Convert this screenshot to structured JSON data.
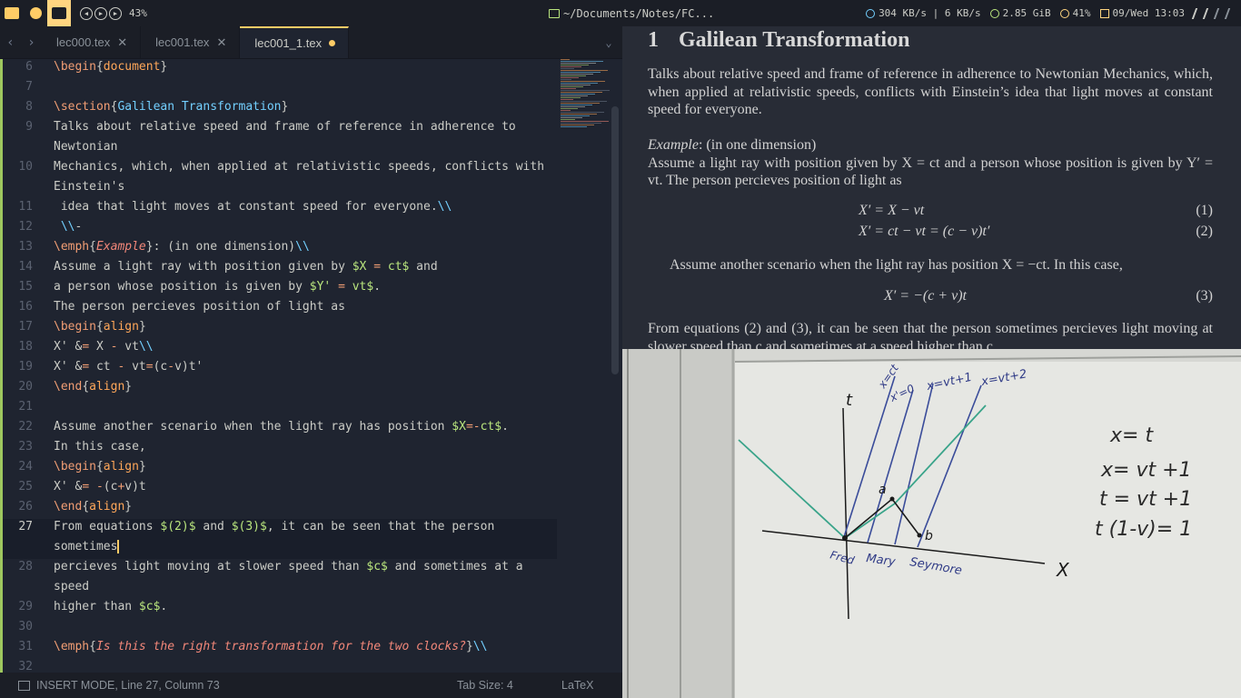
{
  "topbar": {
    "volume": "43%",
    "window_title": "~/Documents/Notes/FC...",
    "network": "304 KB/s | 6 KB/s",
    "memory": "2.85 GiB",
    "battery": "41%",
    "datetime": "09/Wed 13:03"
  },
  "tabs": [
    {
      "label": "lec000.tex",
      "active": false,
      "modified": false
    },
    {
      "label": "lec001.tex",
      "active": false,
      "modified": false
    },
    {
      "label": "lec001_1.tex",
      "active": true,
      "modified": true
    }
  ],
  "editor": {
    "lines": [
      {
        "n": "6",
        "segs": [
          [
            "fn",
            "\\begin"
          ],
          [
            "p",
            "{"
          ],
          [
            "kw",
            "document"
          ],
          [
            "p",
            "}"
          ]
        ]
      },
      {
        "n": "7",
        "segs": []
      },
      {
        "n": "8",
        "segs": [
          [
            "fn",
            "\\section"
          ],
          [
            "p",
            "{"
          ],
          [
            "arg",
            "Galilean Transformation"
          ],
          [
            "p",
            "}"
          ]
        ]
      },
      {
        "n": "9",
        "segs": [
          [
            "p",
            "Talks about relative speed and frame of reference in adherence to"
          ]
        ]
      },
      {
        "n": "",
        "segs": [
          [
            "p",
            "Newtonian"
          ]
        ]
      },
      {
        "n": "10",
        "segs": [
          [
            "p",
            "Mechanics, which, when applied at relativistic speeds, conflicts with"
          ]
        ]
      },
      {
        "n": "",
        "segs": [
          [
            "p",
            "Einstein's"
          ]
        ]
      },
      {
        "n": "11",
        "segs": [
          [
            "p",
            " idea that light moves at constant speed for everyone."
          ],
          [
            "arg",
            "\\\\"
          ]
        ]
      },
      {
        "n": "12",
        "segs": [
          [
            "p",
            " "
          ],
          [
            "arg",
            "\\\\"
          ],
          [
            "p",
            "-"
          ]
        ]
      },
      {
        "n": "13",
        "segs": [
          [
            "fn",
            "\\emph"
          ],
          [
            "p",
            "{"
          ],
          [
            "it",
            "Example"
          ],
          [
            "p",
            "}: (in one dimension)"
          ],
          [
            "arg",
            "\\\\"
          ]
        ]
      },
      {
        "n": "14",
        "segs": [
          [
            "p",
            "Assume a light ray with position given by "
          ],
          [
            "str",
            "$X "
          ],
          [
            "op",
            "="
          ],
          [
            "str",
            " ct$"
          ],
          [
            "p",
            " and"
          ]
        ]
      },
      {
        "n": "15",
        "segs": [
          [
            "p",
            "a person whose position is given by "
          ],
          [
            "str",
            "$Y' "
          ],
          [
            "op",
            "="
          ],
          [
            "str",
            " vt$"
          ],
          [
            "p",
            "."
          ]
        ]
      },
      {
        "n": "16",
        "segs": [
          [
            "p",
            "The person percieves position of light as"
          ]
        ]
      },
      {
        "n": "17",
        "segs": [
          [
            "fn",
            "\\begin"
          ],
          [
            "p",
            "{"
          ],
          [
            "kw",
            "align"
          ],
          [
            "p",
            "}"
          ]
        ]
      },
      {
        "n": "18",
        "segs": [
          [
            "p",
            "X' &"
          ],
          [
            "op",
            "="
          ],
          [
            "p",
            " X "
          ],
          [
            "op",
            "-"
          ],
          [
            "p",
            " vt"
          ],
          [
            "arg",
            "\\\\"
          ]
        ]
      },
      {
        "n": "19",
        "segs": [
          [
            "p",
            "X' &"
          ],
          [
            "op",
            "="
          ],
          [
            "p",
            " ct "
          ],
          [
            "op",
            "-"
          ],
          [
            "p",
            " vt"
          ],
          [
            "op",
            "="
          ],
          [
            "p",
            "(c"
          ],
          [
            "op",
            "-"
          ],
          [
            "p",
            "v)t'"
          ]
        ]
      },
      {
        "n": "20",
        "segs": [
          [
            "fn",
            "\\end"
          ],
          [
            "p",
            "{"
          ],
          [
            "kw",
            "align"
          ],
          [
            "p",
            "}"
          ]
        ]
      },
      {
        "n": "21",
        "segs": []
      },
      {
        "n": "22",
        "segs": [
          [
            "p",
            "Assume another scenario when the light ray has position "
          ],
          [
            "str",
            "$X"
          ],
          [
            "op",
            "=-"
          ],
          [
            "str",
            "ct$"
          ],
          [
            "p",
            "."
          ]
        ]
      },
      {
        "n": "23",
        "segs": [
          [
            "p",
            "In this case,"
          ]
        ]
      },
      {
        "n": "24",
        "segs": [
          [
            "fn",
            "\\begin"
          ],
          [
            "p",
            "{"
          ],
          [
            "kw",
            "align"
          ],
          [
            "p",
            "}"
          ]
        ]
      },
      {
        "n": "25",
        "segs": [
          [
            "p",
            "X' &"
          ],
          [
            "op",
            "="
          ],
          [
            "p",
            " "
          ],
          [
            "op",
            "-"
          ],
          [
            "p",
            "(c"
          ],
          [
            "op",
            "+"
          ],
          [
            "p",
            "v)t"
          ]
        ]
      },
      {
        "n": "26",
        "segs": [
          [
            "fn",
            "\\end"
          ],
          [
            "p",
            "{"
          ],
          [
            "kw",
            "align"
          ],
          [
            "p",
            "}"
          ]
        ]
      },
      {
        "n": "27",
        "segs": [
          [
            "p",
            "From equations "
          ],
          [
            "str",
            "$(2)$"
          ],
          [
            "p",
            " and "
          ],
          [
            "str",
            "$(3)$"
          ],
          [
            "p",
            ", it can be seen that the person"
          ]
        ]
      },
      {
        "n": "",
        "segs": [
          [
            "p",
            "sometimes"
          ]
        ],
        "cursor": true
      },
      {
        "n": "28",
        "segs": [
          [
            "p",
            "percieves light moving at slower speed than "
          ],
          [
            "str",
            "$c$"
          ],
          [
            "p",
            " and sometimes at a"
          ]
        ]
      },
      {
        "n": "",
        "segs": [
          [
            "p",
            "speed"
          ]
        ]
      },
      {
        "n": "29",
        "segs": [
          [
            "p",
            "higher than "
          ],
          [
            "str",
            "$c$"
          ],
          [
            "p",
            "."
          ]
        ]
      },
      {
        "n": "30",
        "segs": []
      },
      {
        "n": "31",
        "segs": [
          [
            "fn",
            "\\emph"
          ],
          [
            "p",
            "{"
          ],
          [
            "it",
            "Is this the right transformation for the two clocks?"
          ],
          [
            "p",
            "}"
          ],
          [
            "arg",
            "\\\\"
          ]
        ]
      },
      {
        "n": "32",
        "segs": []
      }
    ]
  },
  "statusbar": {
    "mode": "INSERT MODE, Line 27, Column 73",
    "tab_size": "Tab Size: 4",
    "syntax": "LaTeX"
  },
  "pdf": {
    "section_number": "1",
    "section_title": "Galilean Transformation",
    "para1": "Talks about relative speed and frame of reference in adherence to Newtonian Mechanics, which, when applied at relativistic speeds, conflicts with Einstein’s idea that light moves at constant speed for everyone.",
    "example_label": "Example",
    "example_rest": ": (in one dimension)",
    "para2": "Assume a light ray with position given by X = ct and a person whose position is given by Y′ = vt. The person percieves position of light as",
    "eq1": "X′ = X − vt",
    "eq1_num": "(1)",
    "eq2": "X′ = ct − vt = (c − v)t′",
    "eq2_num": "(2)",
    "para3": "Assume another scenario when the light ray has position X = −ct. In this case,",
    "eq3": "X′ = −(c + v)t",
    "eq3_num": "(3)",
    "para4": "From equations (2) and (3), it can be seen that the person sometimes percieves light moving at slower speed than c and sometimes at a speed higher than c."
  },
  "whiteboard": {
    "labels": {
      "t": "t",
      "X": "X",
      "xct": "x=ct",
      "x0": "x'=0",
      "xvt1": "x=vt+1",
      "xvt2": "x=vt+2",
      "a": "a",
      "b": "b",
      "fred": "Fred",
      "mary": "Mary",
      "seymore": "Seymore"
    },
    "equations": [
      "x= t",
      "x= vt +1",
      "t = vt +1",
      "t (1-v)= 1"
    ]
  }
}
